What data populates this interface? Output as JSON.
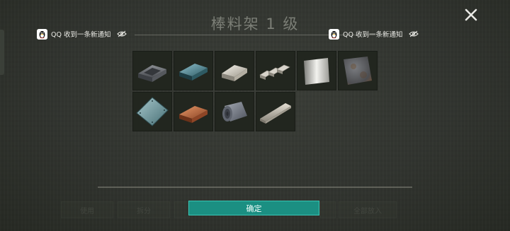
{
  "dialog": {
    "title": "棒料架 1 级",
    "confirm_label": "确定"
  },
  "notifications": [
    {
      "app": "QQ",
      "text": "QQ 收到一条新通知"
    },
    {
      "app": "QQ",
      "text": "QQ 收到一条新通知"
    }
  ],
  "background_buttons": [
    "使用",
    "拆分",
    "",
    "",
    "",
    "全部放入"
  ],
  "items": [
    {
      "icon": "iron-ingot-icon"
    },
    {
      "icon": "steel-ingot-icon"
    },
    {
      "icon": "silver-ingot-icon"
    },
    {
      "icon": "triple-bars-icon"
    },
    {
      "icon": "aluminum-plate-icon"
    },
    {
      "icon": "rusty-plate-icon"
    },
    {
      "icon": "steel-plate-icon"
    },
    {
      "icon": "copper-ingot-icon"
    },
    {
      "icon": "metal-sheet-roll-icon"
    },
    {
      "icon": "steel-bar-icon"
    }
  ]
}
